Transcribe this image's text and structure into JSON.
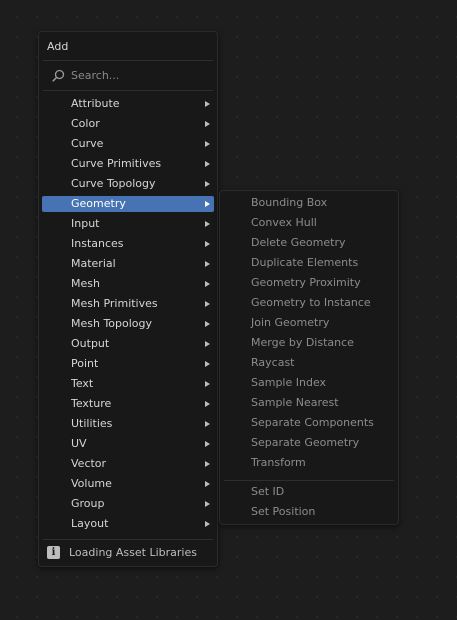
{
  "menu": {
    "title": "Add",
    "search_placeholder": "Search...",
    "items": [
      {
        "label": "Attribute"
      },
      {
        "label": "Color"
      },
      {
        "label": "Curve"
      },
      {
        "label": "Curve Primitives"
      },
      {
        "label": "Curve Topology"
      },
      {
        "label": "Geometry",
        "active": true
      },
      {
        "label": "Input"
      },
      {
        "label": "Instances"
      },
      {
        "label": "Material"
      },
      {
        "label": "Mesh"
      },
      {
        "label": "Mesh Primitives"
      },
      {
        "label": "Mesh Topology"
      },
      {
        "label": "Output"
      },
      {
        "label": "Point"
      },
      {
        "label": "Text"
      },
      {
        "label": "Texture"
      },
      {
        "label": "Utilities"
      },
      {
        "label": "UV"
      },
      {
        "label": "Vector"
      },
      {
        "label": "Volume"
      },
      {
        "label": "Group"
      },
      {
        "label": "Layout"
      }
    ],
    "footer_text": "Loading Asset Libraries",
    "footer_icon": "info-icon"
  },
  "submenu": {
    "items": [
      "Bounding Box",
      "Convex Hull",
      "Delete Geometry",
      "Duplicate Elements",
      "Geometry Proximity",
      "Geometry to Instance",
      "Join Geometry",
      "Merge by Distance",
      "Raycast",
      "Sample Index",
      "Sample Nearest",
      "Separate Components",
      "Separate Geometry",
      "Transform"
    ],
    "items_after_separator": [
      "Set ID",
      "Set Position"
    ]
  },
  "colors": {
    "highlight": "#4772b3",
    "menu_background": "#181818",
    "canvas_background": "#1d1d1d"
  }
}
